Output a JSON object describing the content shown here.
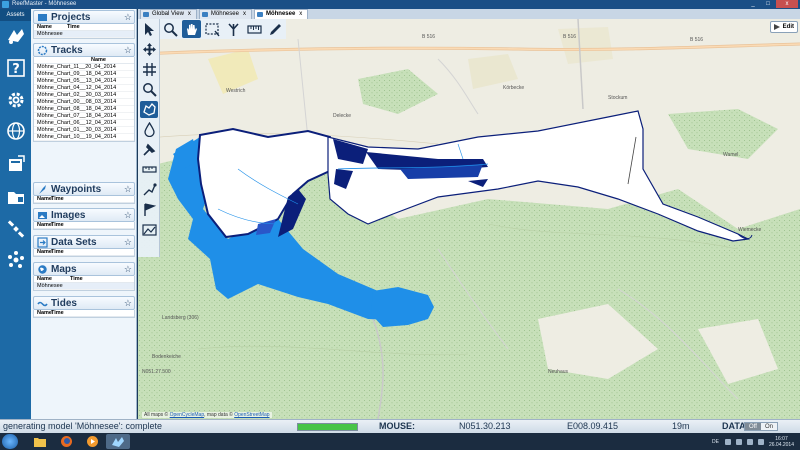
{
  "window": {
    "title": "ReefMaster - Möhnesee"
  },
  "window_controls": [
    "_",
    "□",
    "x"
  ],
  "assets_rail": {
    "label": "Assets"
  },
  "sections": {
    "projects": {
      "title": "Projects",
      "columns": [
        "Name",
        "Time"
      ],
      "rows": [
        "Möhnesee"
      ]
    },
    "tracks": {
      "title": "Tracks",
      "columns": [
        "Name"
      ],
      "rows": [
        "Möhne_Chart_11__20_04_2014",
        "Möhne_Chart_09__18_04_2014",
        "Möhne_Chart_05__13_04_2014",
        "Möhne_Chart_04__12_04_2014",
        "Möhne_Chart_02__30_03_2014",
        "Möhne_Chart_00__08_03_2014",
        "Möhne_Chart_08__18_04_2014",
        "Möhne_Chart_07__18_04_2014",
        "Möhne_Chart_06__12_04_2014",
        "Möhne_Chart_01__30_03_2014",
        "Möhne_Chart_10__19_04_2014"
      ]
    },
    "waypoints": {
      "title": "Waypoints",
      "columns": [
        "Name",
        "Time"
      ]
    },
    "images": {
      "title": "Images",
      "columns": [
        "Name",
        "Time"
      ]
    },
    "datasets": {
      "title": "Data Sets",
      "columns": [
        "Name",
        "Time"
      ]
    },
    "maps": {
      "title": "Maps",
      "columns": [
        "Name",
        "Time"
      ],
      "rows": [
        "Möhnesee"
      ]
    },
    "tides": {
      "title": "Tides",
      "columns": [
        "Name",
        "Time"
      ]
    }
  },
  "tabs": [
    {
      "label": "Global View"
    },
    {
      "label": "Möhnesee"
    },
    {
      "label": "Möhnesee"
    }
  ],
  "edit_button": {
    "label": "Edit"
  },
  "map": {
    "attribution_prefix": "All maps ©",
    "attribution_link1": "OpenCycleMap",
    "attribution_mid": ", map data ©",
    "attribution_link2": "OpenStreetMap",
    "labels": {
      "road_b516_a": "B 516",
      "road_b516_b": "B 516",
      "road_b516_c": "B 516",
      "town_wamel": "Wamel",
      "town_dellwig": "Delecke",
      "town_koerbecke": "Körbecke",
      "town_westrich": "Westrich",
      "town_stockum": "Stockum",
      "town_neuhaus": "Neuhaus",
      "town_berlingsen": "Berlingsen",
      "place_north_coord": "N051.27.500",
      "place_wamel": "Wamel",
      "place_bodenkeiche": "Bodenkeiche",
      "place_dingelsmeld": "Landsberg (306)",
      "place_wiemecke": "Wiemecke"
    },
    "colors": {
      "water": "#1f8fe8",
      "charted_white": "#ffffff",
      "deep": "#0b1f7a",
      "land": "#eeede3",
      "forest": "#c5dfb7"
    }
  },
  "statusbar": {
    "message": "generating model 'Möhnesee': complete",
    "progress": 1.0,
    "mouse_label": "MOUSE:",
    "lat": "N051.30.213",
    "lon": "E008.09.415",
    "distance": "19m",
    "data_label": "DATA:",
    "data_off": "Off",
    "data_on": "On"
  },
  "taskbar": {
    "apps": [
      "start-orb",
      "explorer-icon",
      "firefox-icon",
      "media-icon",
      "reefmaster-icon"
    ],
    "lang": "DE",
    "time": "16:07",
    "date": "26.04.2014"
  }
}
